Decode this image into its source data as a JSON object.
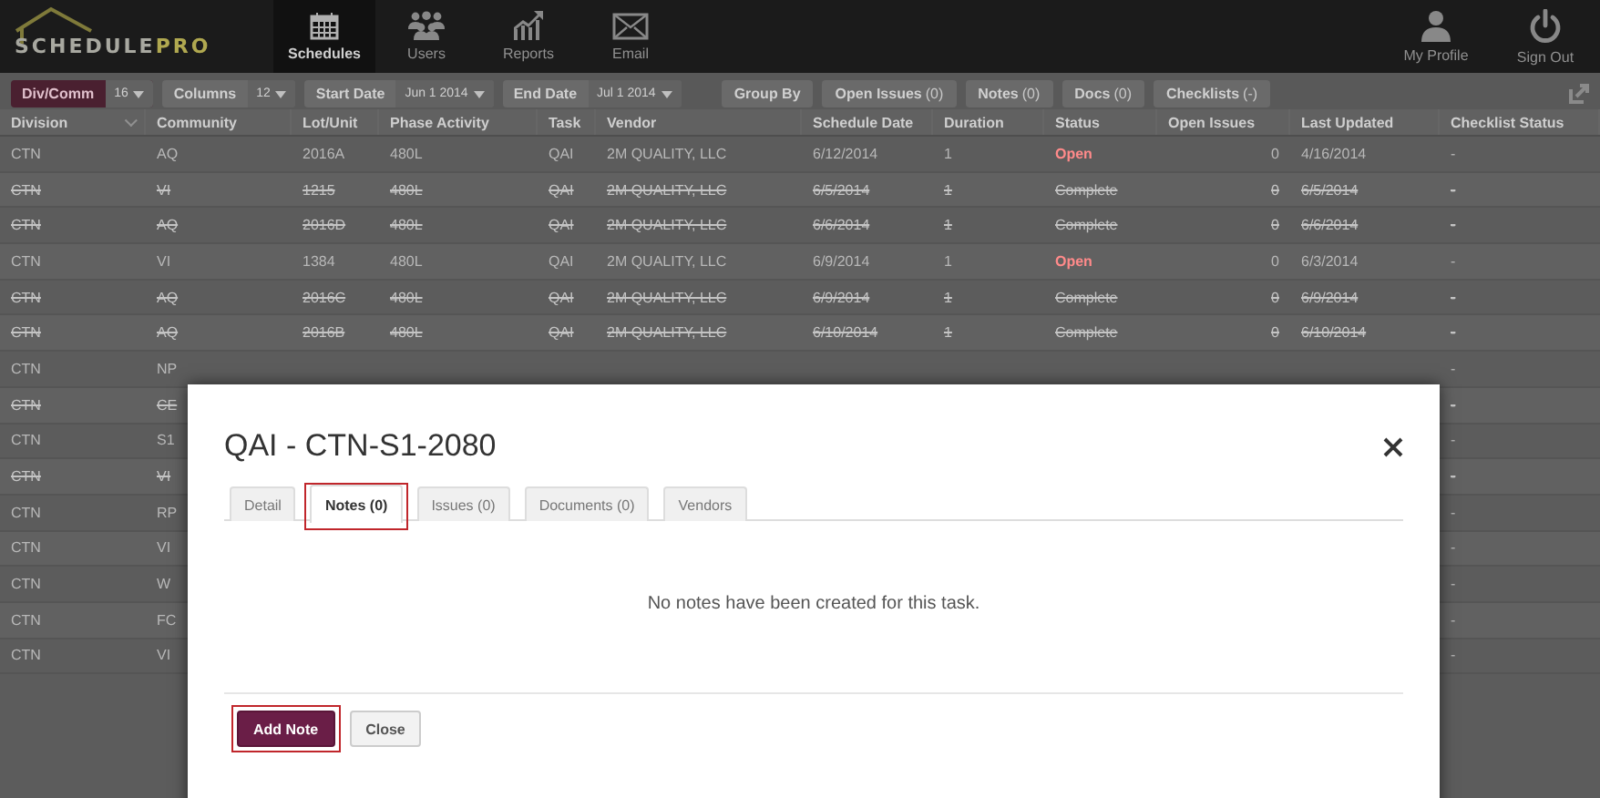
{
  "header": {
    "logo": {
      "part_1": "SCHEDULE",
      "part_2": "PRO"
    },
    "nav": [
      {
        "label": "Schedules",
        "selected": true
      },
      {
        "label": "Users",
        "selected": false
      },
      {
        "label": "Reports",
        "selected": false
      },
      {
        "label": "Email",
        "selected": false
      }
    ],
    "account": [
      {
        "label": "My Profile"
      },
      {
        "label": "Sign Out"
      }
    ]
  },
  "toolbar": {
    "filters": [
      {
        "label": "Div/Comm",
        "value": "16",
        "primary": true
      },
      {
        "label": "Columns",
        "value": "12",
        "primary": false
      },
      {
        "label": "Start Date",
        "value": "Jun 1 2014",
        "primary": false
      },
      {
        "label": "End Date",
        "value": "Jul 1 2014",
        "primary": false
      }
    ],
    "buttons": [
      {
        "label": "Group By"
      },
      {
        "label": "Open Issues",
        "count": "(0)"
      },
      {
        "label": "Notes",
        "count": "(0)"
      },
      {
        "label": "Docs",
        "count": "(0)"
      },
      {
        "label": "Checklists",
        "count": "(-)"
      }
    ]
  },
  "table": {
    "columns": [
      "Division",
      "Community",
      "Lot/Unit",
      "Phase Activity",
      "Task",
      "Vendor",
      "Schedule Date",
      "Duration",
      "Status",
      "Open Issues",
      "Last Updated",
      "Checklist Status"
    ],
    "rows": [
      {
        "cells": [
          "CTN",
          "AQ",
          "2016A",
          "480L",
          "QAI",
          "2M QUALITY, LLC",
          "6/12/2014",
          "1",
          "Open",
          "0",
          "4/16/2014",
          "-"
        ],
        "struck": false
      },
      {
        "cells": [
          "CTN",
          "VI",
          "1215",
          "480L",
          "QAI",
          "2M QUALITY, LLC",
          "6/5/2014",
          "1",
          "Complete",
          "0",
          "6/5/2014",
          "-"
        ],
        "struck": true
      },
      {
        "cells": [
          "CTN",
          "AQ",
          "2016D",
          "480L",
          "QAI",
          "2M QUALITY, LLC",
          "6/6/2014",
          "1",
          "Complete",
          "0",
          "6/6/2014",
          "-"
        ],
        "struck": true
      },
      {
        "cells": [
          "CTN",
          "VI",
          "1384",
          "480L",
          "QAI",
          "2M QUALITY, LLC",
          "6/9/2014",
          "1",
          "Open",
          "0",
          "6/3/2014",
          "-"
        ],
        "struck": false
      },
      {
        "cells": [
          "CTN",
          "AQ",
          "2016C",
          "480L",
          "QAI",
          "2M QUALITY, LLC",
          "6/9/2014",
          "1",
          "Complete",
          "0",
          "6/9/2014",
          "-"
        ],
        "struck": true
      },
      {
        "cells": [
          "CTN",
          "AQ",
          "2016B",
          "480L",
          "QAI",
          "2M QUALITY, LLC",
          "6/10/2014",
          "1",
          "Complete",
          "0",
          "6/10/2014",
          "-"
        ],
        "struck": true
      },
      {
        "cells": [
          "CTN",
          "NP",
          null,
          null,
          null,
          null,
          null,
          null,
          null,
          null,
          null,
          "-"
        ],
        "struck": false
      },
      {
        "cells": [
          "CTN",
          "CE",
          null,
          null,
          null,
          null,
          null,
          null,
          null,
          null,
          null,
          "-"
        ],
        "struck": true
      },
      {
        "cells": [
          "CTN",
          "S1",
          null,
          null,
          null,
          null,
          null,
          null,
          null,
          null,
          null,
          "-"
        ],
        "struck": false
      },
      {
        "cells": [
          "CTN",
          "VI",
          null,
          null,
          null,
          null,
          null,
          null,
          null,
          null,
          null,
          "-"
        ],
        "struck": true
      },
      {
        "cells": [
          "CTN",
          "RP",
          null,
          null,
          null,
          null,
          null,
          null,
          null,
          null,
          null,
          "-"
        ],
        "struck": false
      },
      {
        "cells": [
          "CTN",
          "VI",
          null,
          null,
          null,
          null,
          null,
          null,
          null,
          null,
          null,
          "-"
        ],
        "struck": false
      },
      {
        "cells": [
          "CTN",
          "W",
          null,
          null,
          null,
          null,
          null,
          null,
          null,
          null,
          null,
          "-"
        ],
        "struck": false
      },
      {
        "cells": [
          "CTN",
          "FC",
          null,
          null,
          null,
          null,
          null,
          null,
          null,
          null,
          null,
          "-"
        ],
        "struck": false
      },
      {
        "cells": [
          "CTN",
          "VI",
          null,
          null,
          null,
          null,
          null,
          null,
          null,
          null,
          null,
          "-"
        ],
        "struck": false
      }
    ]
  },
  "modal": {
    "title": "QAI - CTN-S1-2080",
    "tabs": [
      {
        "label": "Detail",
        "selected": false,
        "highlighted": false
      },
      {
        "label": "Notes (0)",
        "selected": true,
        "highlighted": true
      },
      {
        "label": "Issues (0)",
        "selected": false,
        "highlighted": false
      },
      {
        "label": "Documents (0)",
        "selected": false,
        "highlighted": false
      },
      {
        "label": "Vendors",
        "selected": false,
        "highlighted": false
      }
    ],
    "message": "No notes have been created for this task.",
    "buttons": [
      {
        "label": "Add Note",
        "kind": "primary",
        "highlighted": true
      },
      {
        "label": "Close",
        "kind": "default",
        "highlighted": false
      }
    ]
  }
}
